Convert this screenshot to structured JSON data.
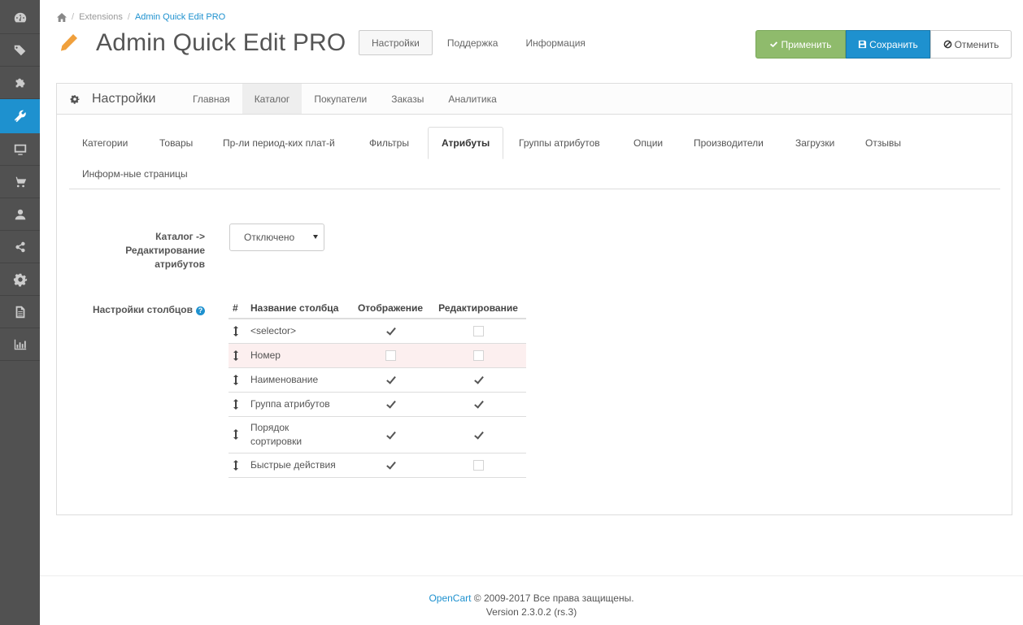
{
  "sidebar": {
    "items": [
      {
        "icon": "dashboard-icon"
      },
      {
        "icon": "tags-icon"
      },
      {
        "icon": "puzzle-icon"
      },
      {
        "icon": "wrench-icon",
        "active": true
      },
      {
        "icon": "desktop-icon"
      },
      {
        "icon": "cart-icon"
      },
      {
        "icon": "user-icon"
      },
      {
        "icon": "share-icon"
      },
      {
        "icon": "cog-icon"
      },
      {
        "icon": "file-icon"
      },
      {
        "icon": "bar-chart-icon"
      }
    ]
  },
  "breadcrumb": {
    "home_icon": "home-icon",
    "items": [
      "Extensions",
      "Admin Quick Edit PRO"
    ]
  },
  "header": {
    "title": "Admin Quick Edit PRO",
    "tabs": [
      "Настройки",
      "Поддержка",
      "Информация"
    ],
    "buttons": {
      "apply": "Применить",
      "save": "Сохранить",
      "cancel": "Отменить"
    },
    "colors": {
      "apply": "#8fbb6c",
      "save": "#1e91cf"
    }
  },
  "panel": {
    "title": "Настройки",
    "main_tabs": [
      "Главная",
      "Каталог",
      "Покупатели",
      "Заказы",
      "Аналитика"
    ],
    "sub_tabs": [
      "Категории",
      "Товары",
      "Пр-ли период-ких плат-й",
      "Фильтры",
      "Атрибуты",
      "Группы атрибутов",
      "Опции",
      "Производители",
      "Загрузки",
      "Отзывы",
      "Информ-ные страницы"
    ],
    "form": {
      "edit_label_1": "Каталог ->",
      "edit_label_2": "Редактирование",
      "edit_label_3": "атрибутов",
      "edit_value": "Отключено",
      "columns_label": "Настройки столбцов",
      "help": "?"
    },
    "table": {
      "headers": [
        "#",
        "Название столбца",
        "Отображение",
        "Редактирование"
      ],
      "rows": [
        {
          "name": "<selector>",
          "display": true,
          "edit": false
        },
        {
          "name": "Номер",
          "display": false,
          "edit": false
        },
        {
          "name": "Наименование",
          "display": true,
          "edit": true
        },
        {
          "name": "Группа атрибутов",
          "display": true,
          "edit": true
        },
        {
          "name_1": "Порядок",
          "name_2": "сортировки",
          "display": true,
          "edit": true
        },
        {
          "name": "Быстрые действия",
          "display": true,
          "edit": false
        }
      ]
    }
  },
  "footer": {
    "brand": "OpenCart",
    "copyright": " © 2009-2017 Все права защищены.",
    "version": "Version 2.3.0.2 (rs.3)"
  }
}
